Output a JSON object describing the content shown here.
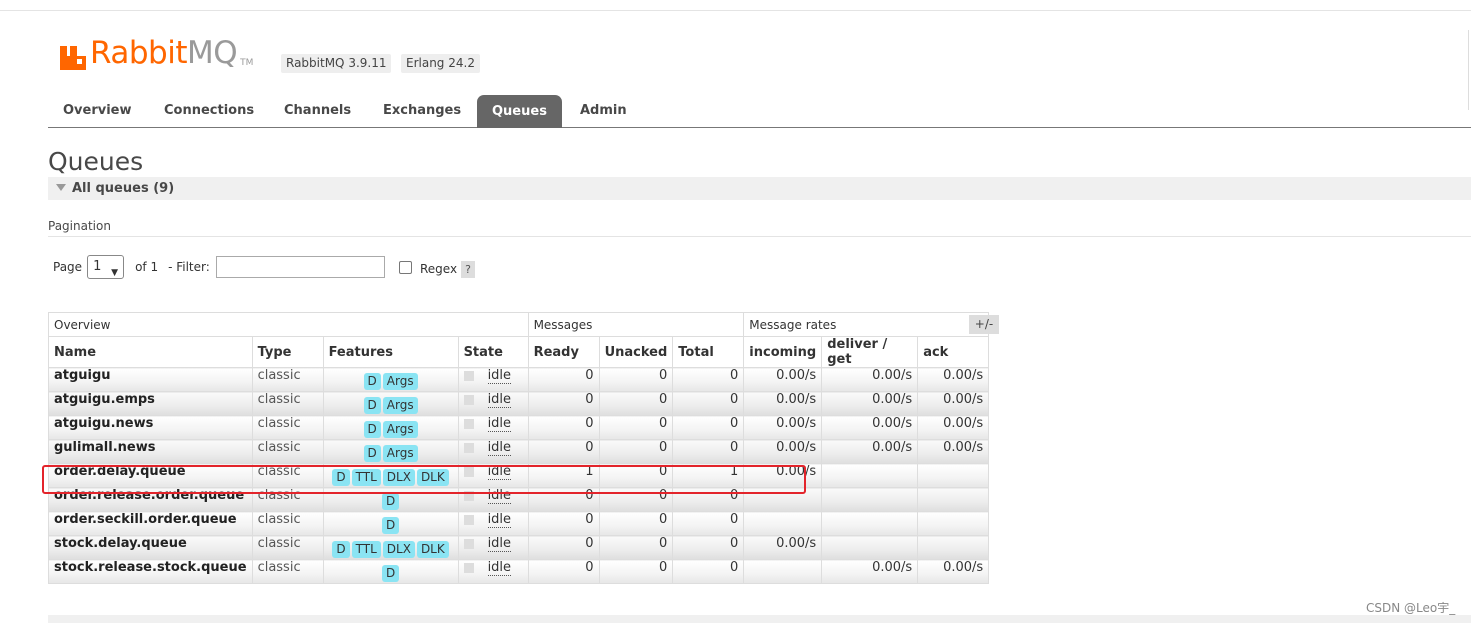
{
  "app": {
    "logo_rabbit": "Rabbit",
    "logo_mq": "MQ",
    "logo_tm": "TM",
    "version_badge": "RabbitMQ 3.9.11",
    "erlang_badge": "Erlang 24.2"
  },
  "tabs": [
    "Overview",
    "Connections",
    "Channels",
    "Exchanges",
    "Queues",
    "Admin"
  ],
  "page": {
    "title": "Queues",
    "section": "All queues (9)",
    "pagination_label": "Pagination",
    "page_label": "Page",
    "page_value": "1",
    "of_label": "of 1",
    "filter_label": "- Filter:",
    "regex_label": "Regex",
    "help_label": "?",
    "toggle_columns": "+/-"
  },
  "table": {
    "groups": [
      "Overview",
      "Messages",
      "Message rates"
    ],
    "columns": [
      "Name",
      "Type",
      "Features",
      "State",
      "Ready",
      "Unacked",
      "Total",
      "incoming",
      "deliver / get",
      "ack"
    ],
    "rows": [
      {
        "name": "atguigu",
        "type": "classic",
        "features": [
          "D",
          "Args"
        ],
        "state": "idle",
        "ready": "0",
        "unacked": "0",
        "total": "0",
        "incoming": "0.00/s",
        "deliver": "0.00/s",
        "ack": "0.00/s"
      },
      {
        "name": "atguigu.emps",
        "type": "classic",
        "features": [
          "D",
          "Args"
        ],
        "state": "idle",
        "ready": "0",
        "unacked": "0",
        "total": "0",
        "incoming": "0.00/s",
        "deliver": "0.00/s",
        "ack": "0.00/s"
      },
      {
        "name": "atguigu.news",
        "type": "classic",
        "features": [
          "D",
          "Args"
        ],
        "state": "idle",
        "ready": "0",
        "unacked": "0",
        "total": "0",
        "incoming": "0.00/s",
        "deliver": "0.00/s",
        "ack": "0.00/s"
      },
      {
        "name": "gulimall.news",
        "type": "classic",
        "features": [
          "D",
          "Args"
        ],
        "state": "idle",
        "ready": "0",
        "unacked": "0",
        "total": "0",
        "incoming": "0.00/s",
        "deliver": "0.00/s",
        "ack": "0.00/s"
      },
      {
        "name": "order.delay.queue",
        "type": "classic",
        "features": [
          "D",
          "TTL",
          "DLX",
          "DLK"
        ],
        "state": "idle",
        "ready": "1",
        "unacked": "0",
        "total": "1",
        "incoming": "0.00/s",
        "deliver": "",
        "ack": ""
      },
      {
        "name": "order.release.order.queue",
        "type": "classic",
        "features": [
          "D"
        ],
        "state": "idle",
        "ready": "0",
        "unacked": "0",
        "total": "0",
        "incoming": "",
        "deliver": "",
        "ack": ""
      },
      {
        "name": "order.seckill.order.queue",
        "type": "classic",
        "features": [
          "D"
        ],
        "state": "idle",
        "ready": "0",
        "unacked": "0",
        "total": "0",
        "incoming": "",
        "deliver": "",
        "ack": ""
      },
      {
        "name": "stock.delay.queue",
        "type": "classic",
        "features": [
          "D",
          "TTL",
          "DLX",
          "DLK"
        ],
        "state": "idle",
        "ready": "0",
        "unacked": "0",
        "total": "0",
        "incoming": "0.00/s",
        "deliver": "",
        "ack": ""
      },
      {
        "name": "stock.release.stock.queue",
        "type": "classic",
        "features": [
          "D"
        ],
        "state": "idle",
        "ready": "0",
        "unacked": "0",
        "total": "0",
        "incoming": "",
        "deliver": "0.00/s",
        "ack": "0.00/s"
      }
    ]
  },
  "watermark": "CSDN @Leo宇_",
  "colors": {
    "brand": "#ff6600",
    "active_tab": "#666666",
    "feature_badge": "#8ae4f3",
    "highlight": "#e3242b"
  }
}
